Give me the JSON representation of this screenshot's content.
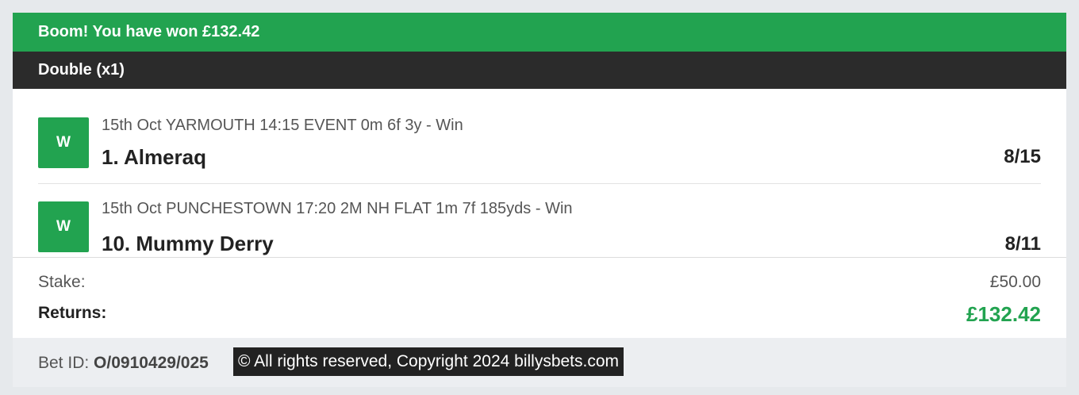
{
  "banner": {
    "text": "Boom! You have won £132.42"
  },
  "bet": {
    "type_label": "Double (x1)"
  },
  "selections": [
    {
      "result": "W",
      "event": "15th Oct YARMOUTH 14:15 EVENT 0m 6f 3y - Win",
      "runner": "1. Almeraq",
      "odds": "8/15"
    },
    {
      "result": "W",
      "event": "15th Oct PUNCHESTOWN 17:20 2M NH FLAT 1m 7f 185yds - Win",
      "runner": "10. Mummy Derry",
      "odds": "8/11"
    }
  ],
  "summary": {
    "stake_label": "Stake:",
    "stake_value": "£50.00",
    "returns_label": "Returns:",
    "returns_value": "£132.42"
  },
  "footer": {
    "bet_id_label": "Bet ID:",
    "bet_id_value": "O/0910429/025",
    "copyright": "© All rights reserved, Copyright 2024 billysbets.com"
  },
  "colors": {
    "win_green": "#22a350",
    "header_dark": "#2b2b2b",
    "page_bg": "#e6e9ec"
  }
}
